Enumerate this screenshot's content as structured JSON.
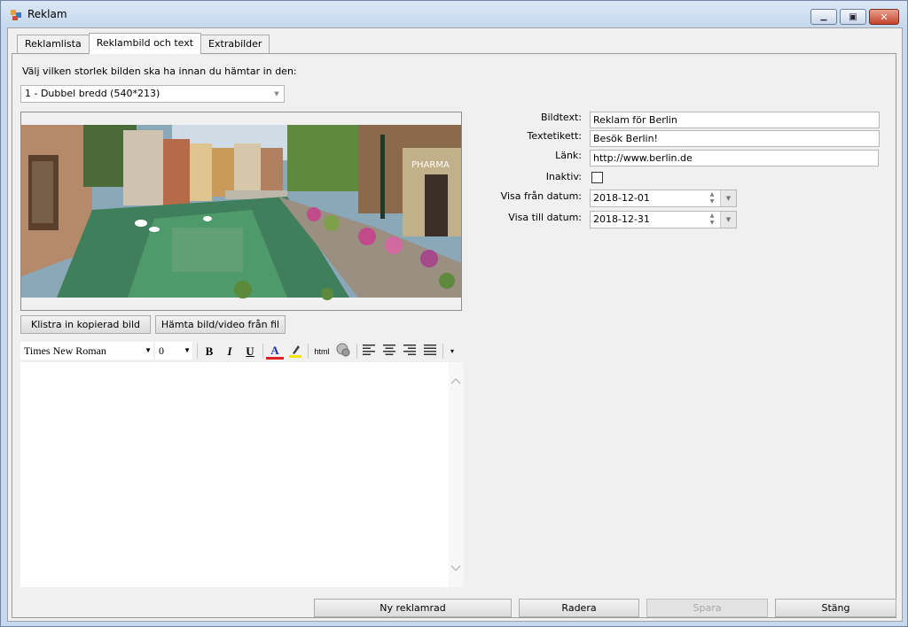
{
  "window": {
    "title": "Reklam",
    "minimize_glyph": "▁",
    "maximize_glyph": "▣",
    "close_glyph": "✕"
  },
  "tabs": [
    {
      "label": "Reklamlista"
    },
    {
      "label": "Reklambild och text"
    },
    {
      "label": "Extrabilder"
    }
  ],
  "image_settings": {
    "size_prompt": "Välj vilken storlek bilden ska ha innan du hämtar in den:",
    "size_selected": "1 - Dubbel bredd (540*213)"
  },
  "image_buttons": {
    "paste": "Klistra in kopierad bild",
    "fetch": "Hämta bild/video från fil"
  },
  "image_photo_sign": "PHARMA",
  "editor": {
    "font": "Times New Roman",
    "size": "0",
    "bold": "B",
    "italic": "I",
    "underline": "U",
    "font_color": "A",
    "html_label": "html"
  },
  "form": {
    "bildtext_label": "Bildtext:",
    "bildtext_value": "Reklam för Berlin",
    "textetikett_label": "Textetikett:",
    "textetikett_value": "Besök Berlin!",
    "lank_label": "Länk:",
    "lank_value": "http://www.berlin.de",
    "inaktiv_label": "Inaktiv:",
    "visa_fran_label": "Visa från datum:",
    "visa_fran_value": "2018-12-01",
    "visa_till_label": "Visa till datum:",
    "visa_till_value": "2018-12-31"
  },
  "footer": {
    "new_row": "Ny reklamrad",
    "delete": "Radera",
    "save": "Spara",
    "close": "Stäng"
  }
}
